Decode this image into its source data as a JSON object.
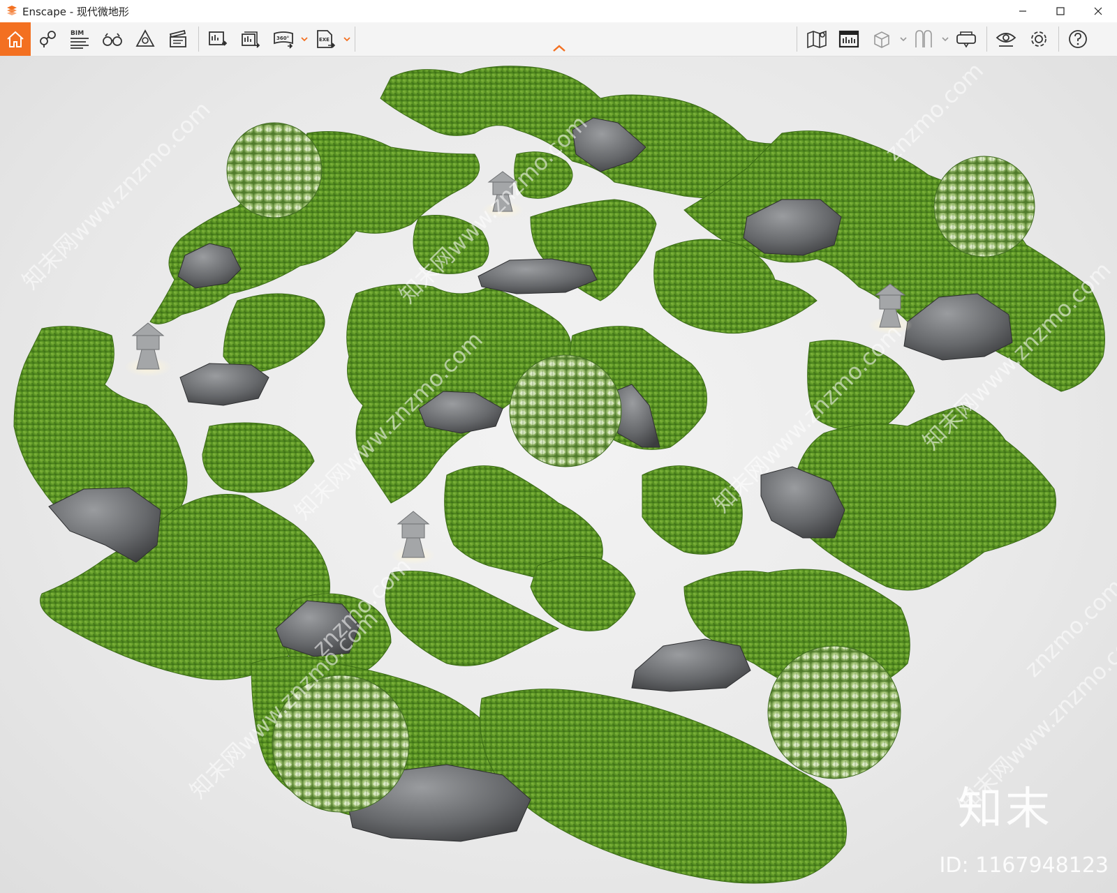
{
  "window": {
    "title": "Enscape - 现代微地形",
    "controls": [
      "minimize",
      "maximize",
      "close"
    ]
  },
  "toolbar": {
    "left_tools": [
      {
        "icon": "home-icon",
        "active": true
      },
      {
        "icon": "views-icon"
      },
      {
        "icon": "bim-icon",
        "label": "BIM"
      },
      {
        "icon": "binoculars-icon"
      },
      {
        "icon": "atmosphere-icon"
      },
      {
        "icon": "video-editor-icon"
      },
      {
        "icon": "render-screenshot-icon"
      },
      {
        "icon": "batch-render-icon"
      },
      {
        "icon": "panorama-icon",
        "label": "360°"
      },
      {
        "icon": "export-exe-icon",
        "label": "EXE"
      }
    ],
    "right_tools": [
      {
        "icon": "map-icon"
      },
      {
        "icon": "material-editor-icon"
      },
      {
        "icon": "asset-library-icon"
      },
      {
        "icon": "collaborative-annotation-icon"
      },
      {
        "icon": "vr-headset-icon"
      },
      {
        "icon": "visual-settings-icon"
      },
      {
        "icon": "settings-icon"
      },
      {
        "icon": "help-icon"
      }
    ],
    "accent_color": "#f37021"
  },
  "viewport": {
    "watermarks": [
      "知末网www.znzmo.com",
      "知末网www.znzmo.com",
      "知末网www.znzmo.com",
      "知末网www.znzmo.com",
      "知末网www.znzmo.com",
      "知末网www.znzmo.com",
      "知末网www.znzmo.com",
      "znzmo.com",
      "znzmo.com",
      "znzmo.com"
    ],
    "logo_text": "知末",
    "id_text": "ID: 1167948123",
    "moss_color": "#4f8a1e",
    "rock_color": "#5d5f62"
  }
}
